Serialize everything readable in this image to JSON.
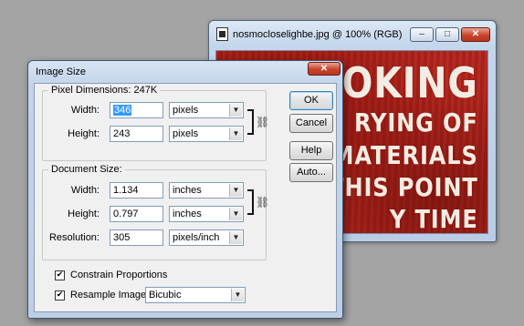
{
  "image_window": {
    "title": "nosmocloselighbe.jpg @ 100% (RGB)",
    "minimize_glyph": "–",
    "maximize_glyph": "□",
    "close_glyph": "✕",
    "sign_lines": [
      "OKING",
      "RYING OF",
      "MATERIALS",
      "THIS POINT",
      "Y TIME"
    ]
  },
  "dialog": {
    "title": "Image Size",
    "close_glyph": "✕",
    "pixel_dimensions": {
      "legend": "Pixel Dimensions:",
      "size": "247K",
      "width_label": "Width:",
      "width_value": "346",
      "width_unit": "pixels",
      "height_label": "Height:",
      "height_value": "243",
      "height_unit": "pixels"
    },
    "document_size": {
      "legend": "Document Size:",
      "width_label": "Width:",
      "width_value": "1.134",
      "width_unit": "inches",
      "height_label": "Height:",
      "height_value": "0.797",
      "height_unit": "inches",
      "resolution_label": "Resolution:",
      "resolution_value": "305",
      "resolution_unit": "pixels/inch"
    },
    "buttons": {
      "ok": "OK",
      "cancel": "Cancel",
      "help": "Help",
      "auto": "Auto..."
    },
    "constrain": {
      "label": "Constrain Proportions",
      "checked": true,
      "mark": "✔"
    },
    "resample": {
      "label": "Resample Image:",
      "checked": true,
      "mark": "✔",
      "method": "Bicubic"
    },
    "link_glyph": "⛓",
    "caret_glyph": "▼"
  }
}
